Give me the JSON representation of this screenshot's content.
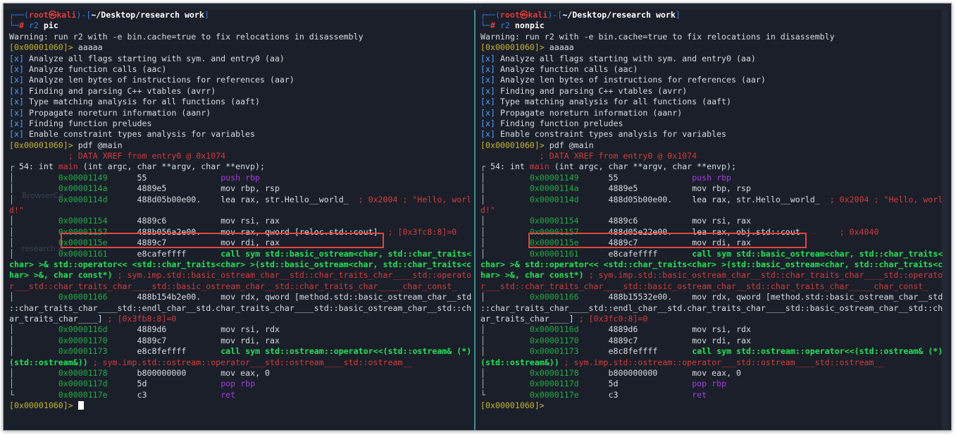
{
  "left": {
    "prompt_user": "root",
    "prompt_host": "kali",
    "prompt_path": "~/Desktop/research work",
    "command_prefix": "r2",
    "command_arg": "pic",
    "warning": "Warning: run r2 with -e bin.cache=true to fix relocations in disassembly",
    "r2_prompt": "[0x00001060]>",
    "cmd_aaaaa": " aaaaa",
    "analysis": [
      "Analyze all flags starting with sym. and entry0 (aa)",
      "Analyze function calls (aac)",
      "Analyze len bytes of instructions for references (aar)",
      "Finding and parsing C++ vtables (avrr)",
      "Type matching analysis for all functions (aaft)",
      "Propagate noreturn information (aanr)",
      "Finding function preludes",
      "Enable constraint types analysis for variables"
    ],
    "cmd_pdf": " pdf @main",
    "xref": "; DATA XREF from entry0 @ 0x1074",
    "func_size": "54: int ",
    "func_name": "main",
    "func_sig": " (int argc, char **argv, char **envp);",
    "asm": [
      {
        "addr": "0x00001149",
        "bytes": "55",
        "op": "push rbp"
      },
      {
        "addr": "0x0000114a",
        "bytes": "4889e5",
        "op": "mov rbp, rsp"
      },
      {
        "addr": "0x0000114d",
        "bytes": "488d05b00e00.",
        "op": "lea rax, str.Hello__world_",
        "cmt": "; 0x2004 ; \"Hello, worl",
        "wrap": "d!\""
      },
      {
        "addr": "0x00001154",
        "bytes": "4889c6",
        "op": "mov rsi, rax"
      },
      {
        "addr": "0x00001157",
        "bytes": "488b056a2e00.",
        "op": "mov rax, qword [reloc.std::cout]",
        "cmt": "; [0x3fc8:8]=0"
      },
      {
        "addr": "0x0000115e",
        "bytes": "4889c7",
        "op": "mov rdi, rax"
      },
      {
        "addr": "0x00001161",
        "bytes": "e8cafeffff",
        "op": "call sym std::basic_ostream<char, std::char_traits<"
      }
    ],
    "call1_wrap1": "char> >& std::operator<< <std::char_traits<char> >(std::basic_ostream<char, std::char_traits<c",
    "call1_wrap2a": "har> >&, char const*)",
    "call1_wrap2b": " ; sym.imp.std::basic_ostream_char__std::char_traits_char____std::operato",
    "call1_wrap3": "r___std::char_traits_char____std::basic_ostream_char__std::char_traits_char_____char_const_",
    "asm2": {
      "addr": "0x00001166",
      "bytes": "488b154b2e00.",
      "op": "mov rdx, qword [method.std::basic_ostream_char__std"
    },
    "asm2_wrap1": "::char_traits_char____std::endl_char__std.char_traits_char____std::basic_ostream_char__std::ch",
    "asm2_wrap2": "ar_traits_char____]",
    "asm2_cmt": " ; [0x3fb8:8]=0",
    "asm3": [
      {
        "addr": "0x0000116d",
        "bytes": "4889d6",
        "op": "mov rsi, rdx"
      },
      {
        "addr": "0x00001170",
        "bytes": "4889c7",
        "op": "mov rdi, rax"
      },
      {
        "addr": "0x00001173",
        "bytes": "e8c8feffff",
        "op": "call sym std::ostream::operator<<(std::ostream& (*)"
      }
    ],
    "call2_wrap_a": "(std::ostream&))",
    "call2_wrap_b": " ; sym.imp.std::ostream::operator___std::ostream____std::ostream__",
    "asm4": [
      {
        "addr": "0x00001178",
        "bytes": "b800000000",
        "op": "mov eax, 0"
      },
      {
        "addr": "0x0000117d",
        "bytes": "5d",
        "op": "pop rbp"
      },
      {
        "addr": "0x0000117e",
        "bytes": "c3",
        "op": "ret"
      }
    ],
    "final_prompt": "[0x00001060]>",
    "ghost1": "BrowserCa",
    "ghost2": "research.w"
  },
  "right": {
    "prompt_user": "root",
    "prompt_host": "kali",
    "prompt_path": "~/Desktop/research work",
    "command_prefix": "r2",
    "command_arg": "nonpic",
    "warning": "Warning: run r2 with -e bin.cache=true to fix relocations in disassembly",
    "r2_prompt": "[0x00001060]>",
    "cmd_aaaaa": " aaaaa",
    "analysis": [
      "Analyze all flags starting with sym. and entry0 (aa)",
      "Analyze function calls (aac)",
      "Analyze len bytes of instructions for references (aar)",
      "Finding and parsing C++ vtables (avrr)",
      "Type matching analysis for all functions (aaft)",
      "Propagate noreturn information (aanr)",
      "Finding function preludes",
      "Enable constraint types analysis for variables"
    ],
    "cmd_pdf": " pdf @main",
    "xref": "; DATA XREF from entry0 @ 0x1074",
    "func_size": "54: int ",
    "func_name": "main",
    "func_sig": " (int argc, char **argv, char **envp);",
    "asm": [
      {
        "addr": "0x00001149",
        "bytes": "55",
        "op": "push rbp"
      },
      {
        "addr": "0x0000114a",
        "bytes": "4889e5",
        "op": "mov rbp, rsp"
      },
      {
        "addr": "0x0000114d",
        "bytes": "488d05b00e00.",
        "op": "lea rax, str.Hello__world_",
        "cmt": "; 0x2004 ; \"Hello, worl",
        "wrap": "d!\""
      },
      {
        "addr": "0x00001154",
        "bytes": "4889c6",
        "op": "mov rsi, rax"
      },
      {
        "addr": "0x00001157",
        "bytes": "488d05e22e00.",
        "op": "lea rax, obj.std::cout",
        "cmt": "; 0x4040"
      },
      {
        "addr": "0x0000115e",
        "bytes": "4889c7",
        "op": "mov rdi, rax"
      },
      {
        "addr": "0x00001161",
        "bytes": "e8cafeffff",
        "op": "call sym std::basic_ostream<char, std::char_traits<"
      }
    ],
    "call1_wrap1": "char> >& std::operator<< <std::char_traits<char> >(std::basic_ostream<char, std::char_traits<c",
    "call1_wrap2a": "har> >&, char const*)",
    "call1_wrap2b": " ; sym.imp.std::basic_ostream_char__std::char_traits_char____std::operato",
    "call1_wrap3": "r___std::char_traits_char____std::basic_ostream_char__std::char_traits_char_____char_const_",
    "asm2": {
      "addr": "0x00001166",
      "bytes": "488b15532e00.",
      "op": "mov rdx, qword [method.std::basic_ostream_char__std"
    },
    "asm2_wrap1": "::char_traits_char____std::endl_char__std.char_traits_char____std::basic_ostream_char__std::ch",
    "asm2_wrap2": "ar_traits_char____]",
    "asm2_cmt": " ; [0x3fc0:8]=0",
    "asm3": [
      {
        "addr": "0x0000116d",
        "bytes": "4889d6",
        "op": "mov rsi, rdx"
      },
      {
        "addr": "0x00001170",
        "bytes": "4889c7",
        "op": "mov rdi, rax"
      },
      {
        "addr": "0x00001173",
        "bytes": "e8c8feffff",
        "op": "call sym std::ostream::operator<<(std::ostream& (*)"
      }
    ],
    "call2_wrap_a": "(std::ostream&))",
    "call2_wrap_b": " ; sym.imp.std::ostream::operator___std::ostream____std::ostream__",
    "asm4": [
      {
        "addr": "0x00001178",
        "bytes": "b800000000",
        "op": "mov eax, 0"
      },
      {
        "addr": "0x0000117d",
        "bytes": "5d",
        "op": "pop rbp"
      },
      {
        "addr": "0x0000117e",
        "bytes": "c3",
        "op": "ret"
      }
    ],
    "final_prompt": "[0x00001060]>"
  },
  "colors": {
    "background": "#1a1f29",
    "divider": "#3d8f96",
    "highlight": "#e0483d",
    "prompt": "#2f7de6",
    "addr": "#1fae48",
    "call": "#22e35a"
  }
}
